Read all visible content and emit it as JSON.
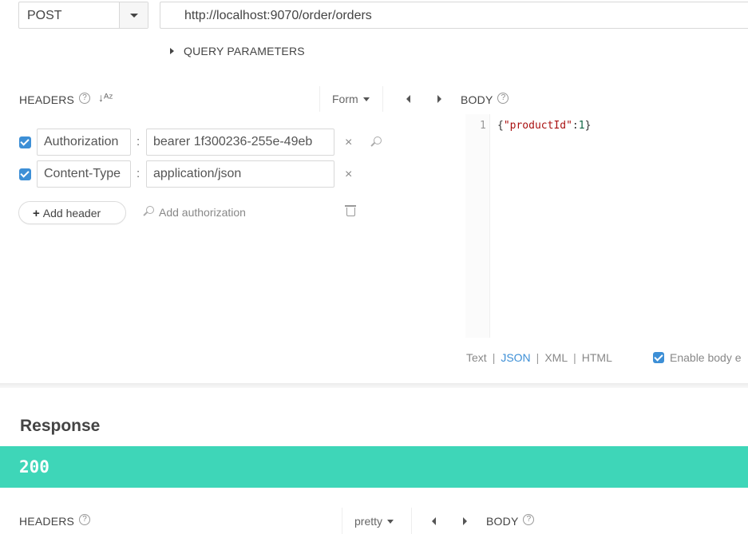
{
  "request": {
    "method": "POST",
    "url": "http://localhost:9070/order/orders",
    "query_parameters_label": "QUERY PARAMETERS"
  },
  "headers_section": {
    "title": "HEADERS",
    "help": "?",
    "sort_icon": "↓ᴬᶻ",
    "mode_tab": "Form",
    "rows": [
      {
        "enabled": true,
        "name": "Authorization",
        "value": "bearer 1f300236-255e-49eb"
      },
      {
        "enabled": true,
        "name": "Content-Type",
        "value": "application/json"
      }
    ],
    "colon": ":",
    "remove": "×",
    "add_header_label": "Add header",
    "add_header_icon": "+",
    "add_authorization_label": "Add authorization"
  },
  "body_section": {
    "title": "BODY",
    "help": "?",
    "line_number": "1",
    "code": {
      "open": "{",
      "key": "\"productId\"",
      "colon": ":",
      "value": "1",
      "close": "}"
    },
    "types": [
      "Text",
      "JSON",
      "XML",
      "HTML"
    ],
    "active_type": "JSON",
    "type_separator": "|",
    "enable_body_label": "Enable body e"
  },
  "response": {
    "title": "Response",
    "status_code": "200",
    "status_color": "#3ed6b8",
    "headers_title": "HEADERS",
    "help": "?",
    "format_tab": "pretty",
    "body_title": "BODY"
  },
  "colors": {
    "accent": "#3d8fd6",
    "success": "#3ed6b8"
  }
}
